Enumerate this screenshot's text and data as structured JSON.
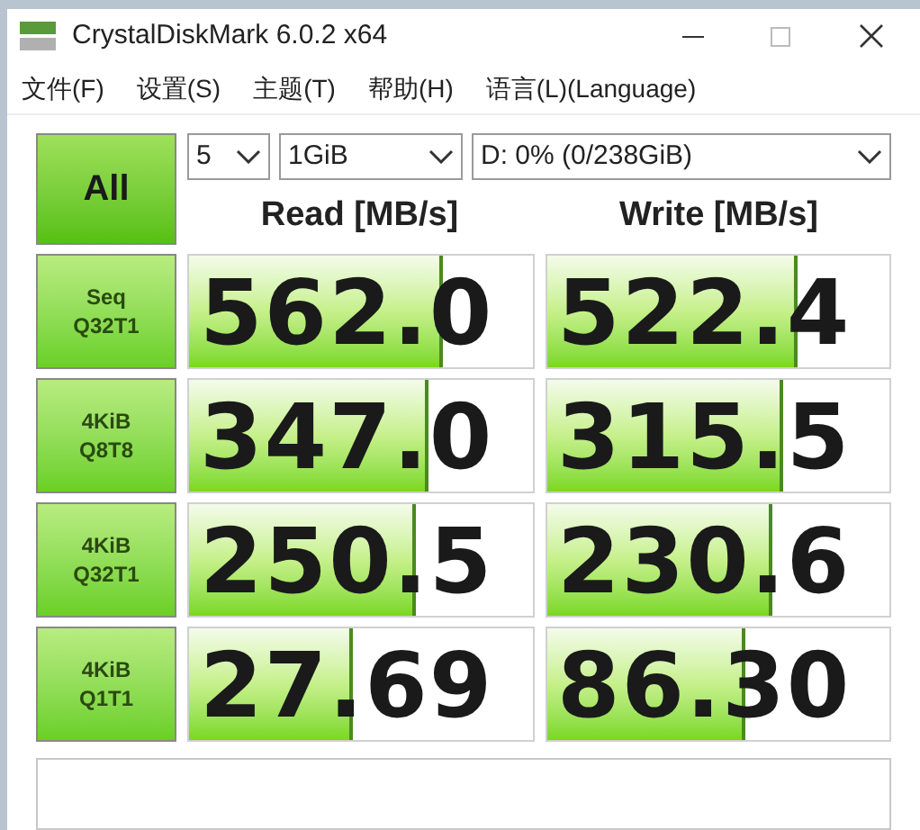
{
  "window": {
    "title": "CrystalDiskMark 6.0.2 x64"
  },
  "menu": [
    "文件(F)",
    "设置(S)",
    "主题(T)",
    "帮助(H)",
    "语言(L)(Language)"
  ],
  "all_button": "All",
  "selectors": [
    {
      "value": "5"
    },
    {
      "value": "1GiB"
    },
    {
      "value": "D: 0% (0/238GiB)"
    }
  ],
  "columns": [
    "Read [MB/s]",
    "Write [MB/s]"
  ],
  "rows": [
    {
      "test": [
        "Seq",
        "Q32T1"
      ],
      "read": {
        "reading": "562.0",
        "level": 0.74
      },
      "write": {
        "reading": "522.4",
        "level": 0.73
      }
    },
    {
      "test": [
        "4KiB",
        "Q8T8"
      ],
      "read": {
        "reading": "347.0",
        "level": 0.7
      },
      "write": {
        "reading": "315.5",
        "level": 0.69
      }
    },
    {
      "test": [
        "4KiB",
        "Q32T1"
      ],
      "read": {
        "reading": "250.5",
        "level": 0.66
      },
      "write": {
        "reading": "230.6",
        "level": 0.66
      }
    },
    {
      "test": [
        "4KiB",
        "Q1T1"
      ],
      "read": {
        "reading": "27.69",
        "level": 0.48
      },
      "write": {
        "reading": "86.30",
        "level": 0.58
      }
    }
  ]
}
